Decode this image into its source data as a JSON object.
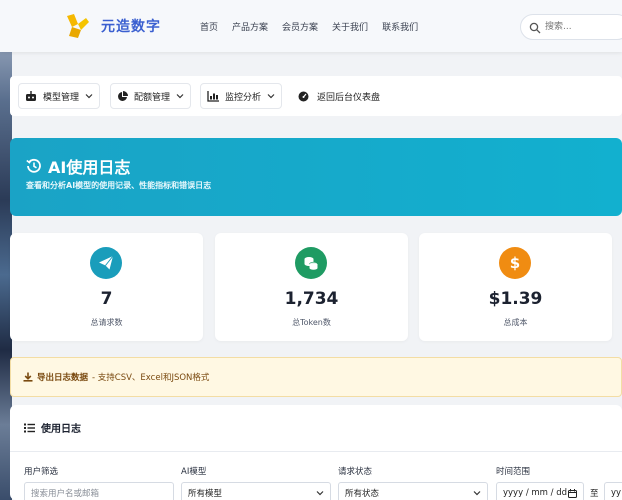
{
  "nav": {
    "brand": "元造数字",
    "links": [
      "首页",
      "产品方案",
      "会员方案",
      "关于我们",
      "联系我们"
    ],
    "search_placeholder": "搜索..."
  },
  "toolbar": {
    "model_mgmt": "模型管理",
    "quota_mgmt": "配额管理",
    "monitor": "监控分析",
    "back_dashboard": "返回后台仪表盘"
  },
  "hero": {
    "title": "AI使用日志",
    "subtitle": "查看和分析AI模型的使用记录、性能指标和错误日志"
  },
  "stats": [
    {
      "value": "7",
      "label": "总请求数",
      "icon": "paper-plane-icon",
      "color": "#1a9dbb"
    },
    {
      "value": "1,734",
      "label": "总Token数",
      "icon": "coins-icon",
      "color": "#1f9b63"
    },
    {
      "value": "$1.39",
      "label": "总成本",
      "icon": "dollar-icon",
      "color": "#f08c12"
    }
  ],
  "alert": {
    "strong": "导出日志数据",
    "text": "- 支持CSV、Excel和JSON格式"
  },
  "logs": {
    "title": "使用日志",
    "filters": {
      "user_label": "用户筛选",
      "user_placeholder": "搜索用户名或邮箱",
      "model_label": "AI模型",
      "model_value": "所有模型",
      "status_label": "请求状态",
      "status_value": "所有状态",
      "time_label": "时间范围",
      "date_start_placeholder": "yyyy / mm / dd",
      "to": "至",
      "date_end_placeholder": "yy"
    }
  }
}
